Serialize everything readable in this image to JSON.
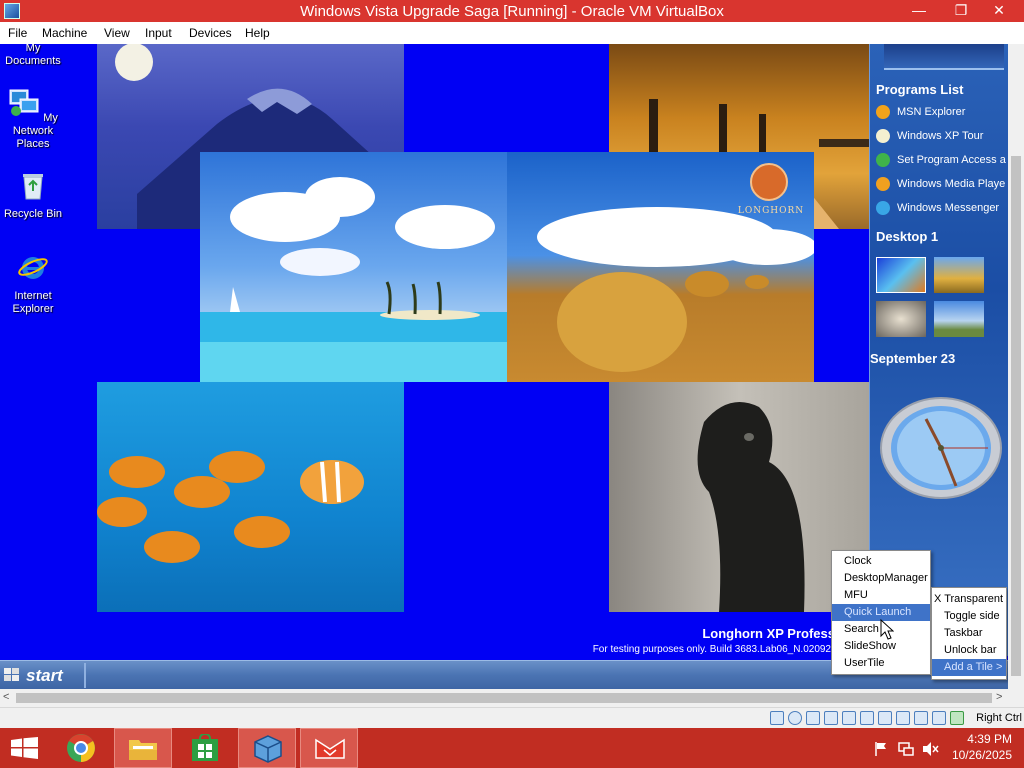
{
  "window": {
    "title": "Windows Vista Upgrade Saga [Running] - Oracle VM VirtualBox",
    "minimize_glyph": "—",
    "restore_glyph": "❐",
    "close_glyph": "✕"
  },
  "menu": [
    "File",
    "Machine",
    "View",
    "Input",
    "Devices",
    "Help"
  ],
  "desktop_icons": [
    "My Documents",
    "My Network Places",
    "Recycle Bin",
    "Internet Explorer"
  ],
  "branding": {
    "logo_text": "LONGHORN",
    "watermark_title": "Longhorn XP Profess",
    "watermark_build": "For testing purposes only. Build 3683.Lab06_N.02092"
  },
  "sidebar": {
    "programs_header": "Programs List",
    "programs": [
      "MSN Explorer",
      "Windows XP Tour",
      "Set Program Access a",
      "Windows Media Playe",
      "Windows Messenger"
    ],
    "desktop_header": "Desktop 1",
    "date_header": "September 23"
  },
  "guest_taskbar": {
    "start_label": "start"
  },
  "tile_menu": {
    "items": [
      "Clock",
      "DesktopManager",
      "MFU",
      "Quick Launch",
      "Search",
      "SlideShow",
      "UserTile"
    ],
    "highlighted": "Quick Launch"
  },
  "bar_menu": {
    "items": [
      "X Transparent",
      "Toggle side",
      "Taskbar",
      "Unlock bar",
      "Add a Tile >"
    ],
    "highlighted": "Add a Tile >"
  },
  "status": {
    "host_key": "Right Ctrl"
  },
  "host_clock": {
    "time": "4:39 PM",
    "date": "10/26/2025"
  },
  "icons": [
    "virtualbox-icon",
    "my-documents-icon",
    "network-places-icon",
    "recycle-bin-icon",
    "internet-explorer-icon",
    "windows-start-icon",
    "chrome-icon",
    "file-explorer-icon",
    "store-icon",
    "virtualbox-taskbar-icon",
    "screenshot-tool-icon",
    "flag-icon",
    "network-icon",
    "mute-icon",
    "mouse-cursor-icon"
  ],
  "colors": {
    "guest_desktop": "#0000f4",
    "host_accent": "#d9352f",
    "sidebar": "#1b4ea5",
    "menu_highlight": "#3f73c8"
  }
}
